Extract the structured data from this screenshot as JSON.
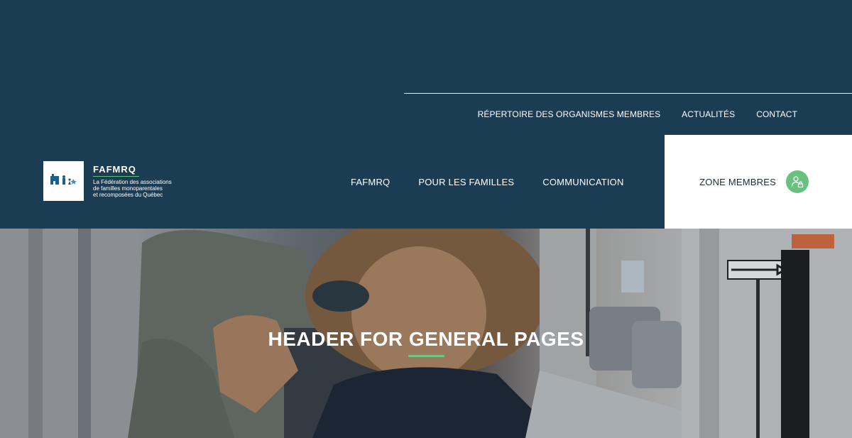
{
  "top_nav": {
    "items": [
      {
        "label": "RÉPERTOIRE DES ORGANISMES MEMBRES"
      },
      {
        "label": "ACTUALITÉS"
      },
      {
        "label": "CONTACT"
      }
    ]
  },
  "logo": {
    "name": "FAFMRQ",
    "description_line1": "La Fédération des associations",
    "description_line2": "de familles monoparentales",
    "description_line3": "et recomposées du Québec"
  },
  "main_nav": {
    "items": [
      {
        "label": "FAFMRQ"
      },
      {
        "label": "POUR LES FAMILLES"
      },
      {
        "label": "COMMUNICATION"
      }
    ]
  },
  "members": {
    "label": "ZONE MEMBRES",
    "icon": "user-lock-icon"
  },
  "hero": {
    "title": "HEADER FOR GENERAL PAGES"
  },
  "colors": {
    "header_bg": "#1b3d54",
    "accent_green": "#69c07f",
    "white": "#ffffff"
  }
}
